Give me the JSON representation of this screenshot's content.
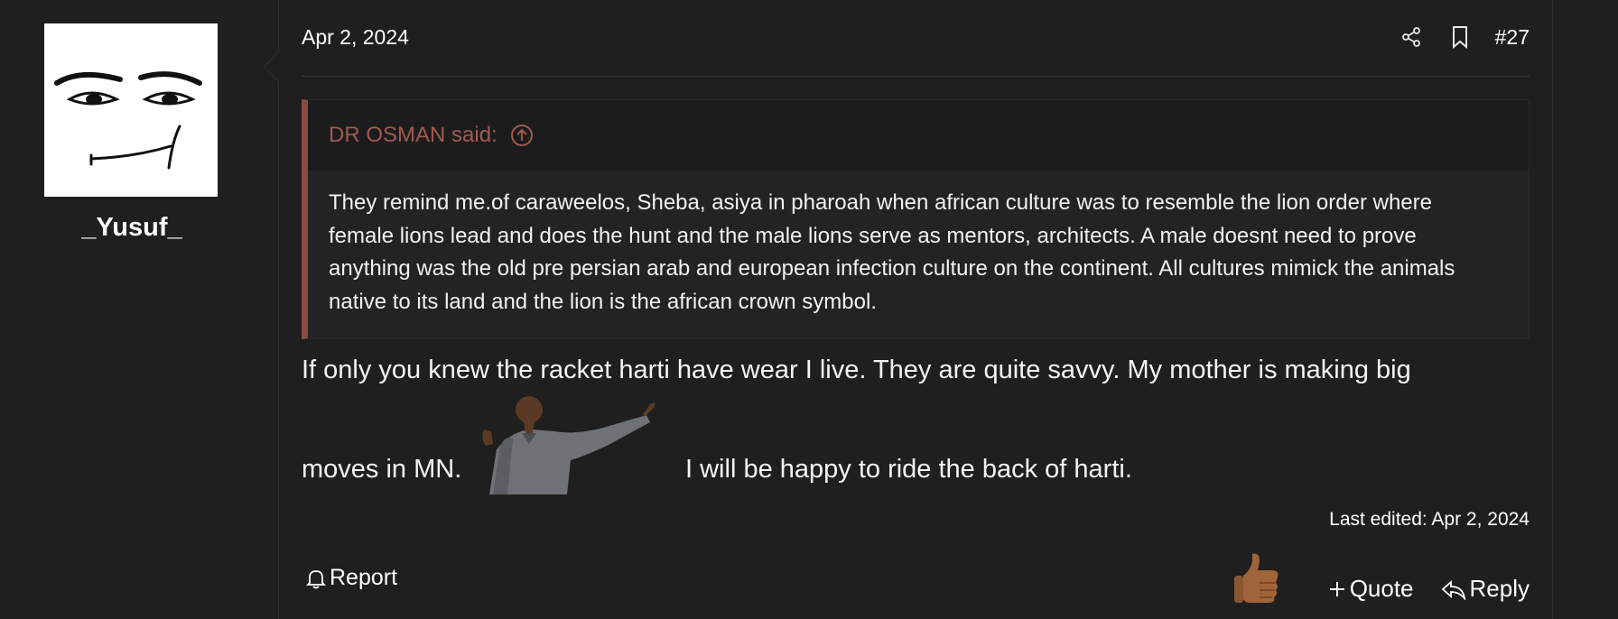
{
  "user": {
    "username": "_Yusuf_",
    "avatar_icon": "avatar-face-icon"
  },
  "post": {
    "date": "Apr 2, 2024",
    "number": "#27",
    "share_icon": "share-icon",
    "bookmark_icon": "bookmark-icon",
    "quote": {
      "author_said": "DR OSMAN said:",
      "goto_icon": "arrow-up-circle-icon",
      "text": "They remind me.of caraweelos, Sheba, asiya in pharoah when african culture was to resemble the lion order where female lions lead and does the hunt and the male lions serve as mentors, architects. A male doesnt need to prove anything was the old pre persian arab and european infection culture on the continent. All cultures mimick the animals native to its land and the lion is the african crown symbol."
    },
    "message": {
      "line1": "If only you knew the racket harti have wear I live. They are quite savvy. My mother is making big",
      "line2a": "moves in MN.",
      "line2b": "I will be happy to ride the back of harti."
    },
    "last_edited": "Last edited: Apr 2, 2024",
    "actions": {
      "report": "Report",
      "quote": "Quote",
      "reply": "Reply"
    }
  },
  "colors": {
    "background": "#1f1f1f",
    "quote_border": "#8a4b45",
    "quote_author": "#a05a52"
  }
}
